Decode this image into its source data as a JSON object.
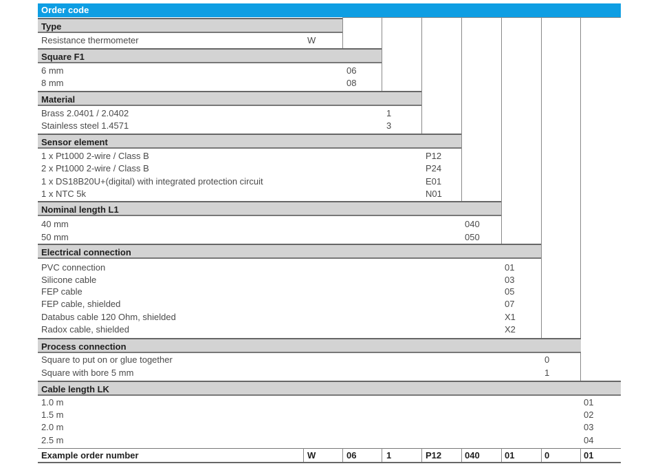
{
  "title": "Order code",
  "sections": {
    "type": {
      "heading": "Type",
      "options": [
        {
          "label": "Resistance thermometer",
          "code": "W"
        }
      ]
    },
    "square": {
      "heading": "Square F1",
      "options": [
        {
          "label": "6 mm",
          "code": "06"
        },
        {
          "label": "8 mm",
          "code": "08"
        }
      ]
    },
    "material": {
      "heading": "Material",
      "options": [
        {
          "label": "Brass 2.0401 / 2.0402",
          "code": "1"
        },
        {
          "label": "Stainless steel 1.4571",
          "code": "3"
        }
      ]
    },
    "sensor": {
      "heading": "Sensor element",
      "options": [
        {
          "label": "1 x Pt1000 2-wire / Class B",
          "code": "P12"
        },
        {
          "label": "2 x Pt1000 2-wire / Class B",
          "code": "P24"
        },
        {
          "label": "1 x DS18B20U+(digital) with integrated protection circuit",
          "code": "E01"
        },
        {
          "label": "1 x NTC 5k",
          "code": "N01"
        }
      ]
    },
    "nominal": {
      "heading": "Nominal length L1",
      "options": [
        {
          "label": "40 mm",
          "code": "040"
        },
        {
          "label": "50 mm",
          "code": "050"
        }
      ]
    },
    "electrical": {
      "heading": "Electrical connection",
      "options": [
        {
          "label": "PVC connection",
          "code": "01"
        },
        {
          "label": "Silicone cable",
          "code": "03"
        },
        {
          "label": "FEP cable",
          "code": "05"
        },
        {
          "label": "FEP cable, shielded",
          "code": "07"
        },
        {
          "label": "Databus cable 120 Ohm, shielded",
          "code": "X1"
        },
        {
          "label": "Radox cable, shielded",
          "code": "X2"
        }
      ]
    },
    "process": {
      "heading": "Process connection",
      "options": [
        {
          "label": "Square to put on or glue together",
          "code": "0"
        },
        {
          "label": "Square with bore 5 mm",
          "code": "1"
        }
      ]
    },
    "cable": {
      "heading": "Cable length LK",
      "options": [
        {
          "label": "1.0 m",
          "code": "01"
        },
        {
          "label": "1.5 m",
          "code": "02"
        },
        {
          "label": "2.0 m",
          "code": "03"
        },
        {
          "label": "2.5 m",
          "code": "04"
        }
      ]
    }
  },
  "example": {
    "label": "Example order number",
    "codes": [
      "W",
      "06",
      "1",
      "P12",
      "040",
      "01",
      "0",
      "01"
    ]
  }
}
